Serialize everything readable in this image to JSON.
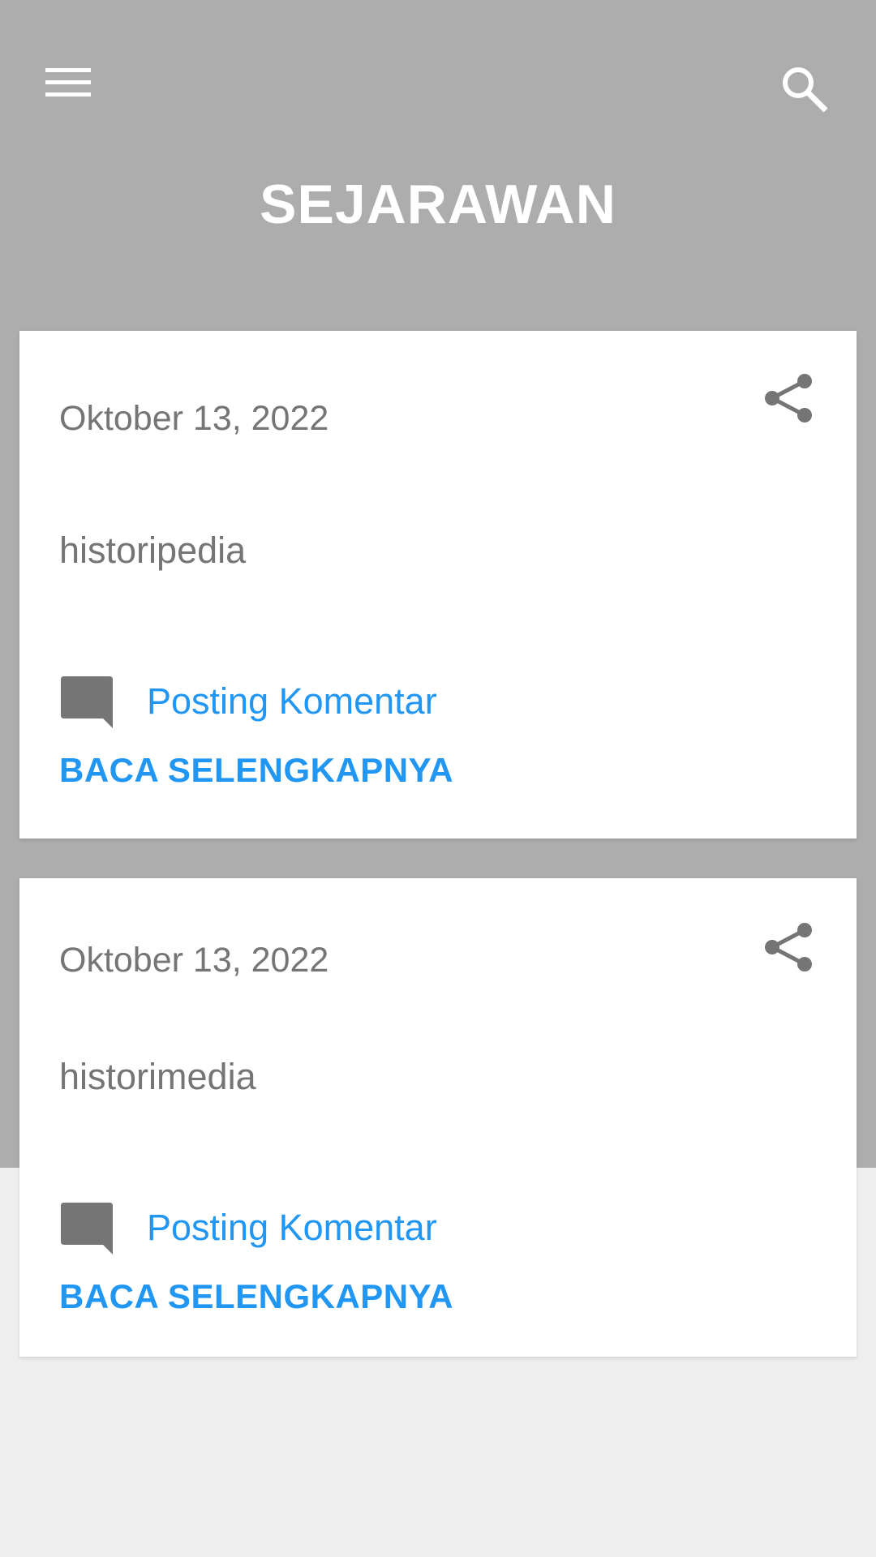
{
  "header": {
    "title": "SEJARAWAN",
    "background_color": "#adadad",
    "menu_icon": "hamburger-menu-icon",
    "search_icon": "search-icon"
  },
  "posts": [
    {
      "date": "Oktober 13, 2022",
      "title": "historipedia",
      "comment_label": "Posting Komentar",
      "read_more_label": "BACA SELENGKAPNYA",
      "share_icon": "share-icon",
      "comment_icon": "comment-icon"
    },
    {
      "date": "Oktober 13, 2022",
      "title": "historimedia",
      "comment_label": "Posting Komentar",
      "read_more_label": "BACA SELENGKAPNYA",
      "share_icon": "share-icon",
      "comment_icon": "comment-icon"
    }
  ],
  "colors": {
    "accent": "#2196f3",
    "muted_text": "#757575",
    "page_background": "#eeeeee"
  }
}
